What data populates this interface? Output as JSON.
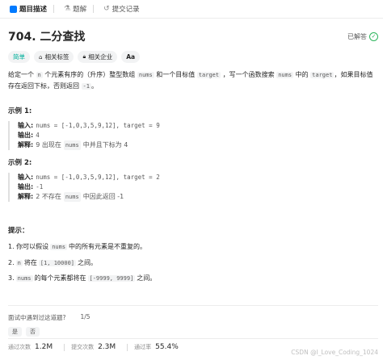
{
  "tabs": [
    {
      "label": "题目描述",
      "icon": "document-icon",
      "color": "#007aff"
    },
    {
      "label": "题解",
      "icon": "flask-icon",
      "color": "#8c8c8c"
    },
    {
      "label": "提交记录",
      "icon": "history-icon",
      "color": "#8c8c8c"
    }
  ],
  "problem": {
    "title": "704. 二分查找",
    "status": "已解答",
    "tags": {
      "difficulty": "简单",
      "topics": "相关标签",
      "companies": "相关企业",
      "font": "Aa"
    },
    "description": {
      "p1": "给定一个 ",
      "c1": "n",
      "p2": " 个元素有序的（升序）整型数组 ",
      "c2": "nums",
      "p3": " 和一个目标值 ",
      "c3": "target",
      "p4": " ，写一个函数搜索 ",
      "c4": "nums",
      "p5": " 中的 ",
      "c5": "target",
      "p6": "，如果目标值存在返回下标，否则返回 ",
      "c6": "-1",
      "p7": "。"
    }
  },
  "examples": [
    {
      "title": "示例 1:",
      "input_label": "输入:",
      "input": "nums = [-1,0,3,5,9,12], target = 9",
      "output_label": "输出:",
      "output": "4",
      "explain_label": "解释:",
      "explain_pre": "9 出现在 ",
      "explain_code": "nums",
      "explain_post": " 中并且下标为 4"
    },
    {
      "title": "示例 2:",
      "input_label": "输入:",
      "input": "nums = [-1,0,3,5,9,12], target = 2",
      "output_label": "输出:",
      "output": "-1",
      "explain_label": "解释:",
      "explain_pre": "2 不存在 ",
      "explain_code": "nums",
      "explain_post": " 中因此返回 -1"
    }
  ],
  "hints": {
    "title": "提示：",
    "items": [
      {
        "pre": "1. 你可以假设 ",
        "code": "nums",
        "post": " 中的所有元素是不重复的。"
      },
      {
        "pre": "2. ",
        "code": "n",
        "mid": " 将在 ",
        "code2": "[1, 10000]",
        "post": "之间。"
      },
      {
        "pre": "3. ",
        "code": "nums",
        "mid": " 的每个元素都将在 ",
        "code2": "[-9999, 9999]",
        "post": "之间。"
      }
    ]
  },
  "footer": {
    "question": "面试中遇到过这道题?",
    "pager": "1/5",
    "yes": "是",
    "no": "否",
    "stats": [
      {
        "label": "通过次数",
        "value": "1.2M"
      },
      {
        "label": "提交次数",
        "value": "2.3M"
      },
      {
        "label": "通过率",
        "value": "55.4%"
      }
    ],
    "watermark": "CSDN @I_Love_Coding_1024"
  }
}
